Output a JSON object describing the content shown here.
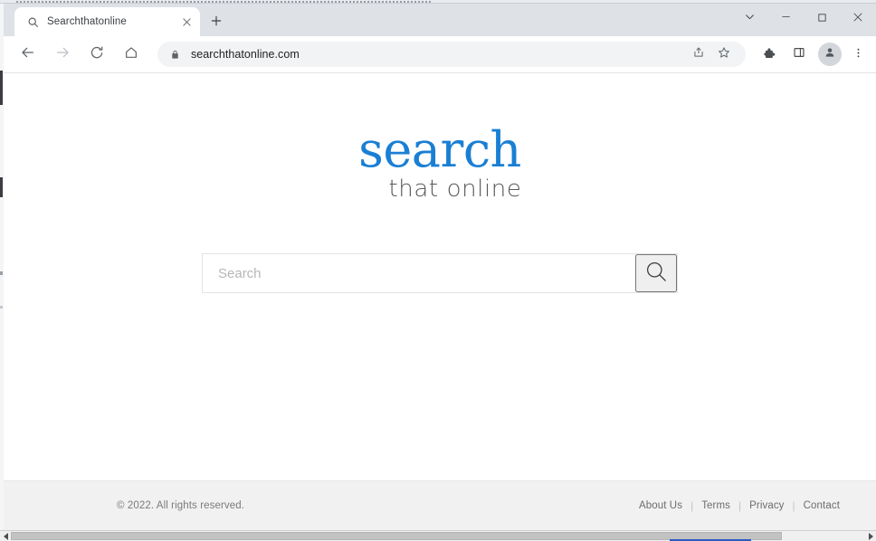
{
  "browser": {
    "tab": {
      "title": "Searchthatonline",
      "favicon_icon": "search-icon",
      "close_icon": "close-icon"
    },
    "new_tab_icon": "plus-icon",
    "window_controls": {
      "chevron_icon": "chevron-down-icon",
      "minimize_icon": "minimize-icon",
      "maximize_icon": "maximize-icon",
      "close_icon": "close-icon"
    },
    "toolbar": {
      "back_icon": "arrow-left-icon",
      "forward_icon": "arrow-right-icon",
      "reload_icon": "reload-icon",
      "home_icon": "home-icon",
      "lock_icon": "lock-icon",
      "url": "searchthatonline.com",
      "share_icon": "share-icon",
      "bookmark_icon": "star-icon",
      "extensions_icon": "puzzle-piece-icon",
      "sidepanel_icon": "side-panel-icon",
      "profile_icon": "avatar-person-icon",
      "menu_icon": "three-dot-menu-icon"
    }
  },
  "page": {
    "logo": {
      "primary_text": "search",
      "secondary_text": "that online",
      "primary_color": "#1a7fd4",
      "secondary_color": "#58595b"
    },
    "search": {
      "placeholder": "Search",
      "value": "",
      "submit_icon": "magnifier-icon"
    },
    "footer": {
      "copyright": "© 2022. All rights reserved.",
      "separator": "|",
      "links": [
        {
          "label": "About Us"
        },
        {
          "label": "Terms"
        },
        {
          "label": "Privacy"
        },
        {
          "label": "Contact"
        }
      ]
    }
  },
  "os": {
    "scrollbar": {
      "left_arrow_icon": "triangle-left-icon",
      "right_arrow_icon": "triangle-right-icon"
    }
  }
}
